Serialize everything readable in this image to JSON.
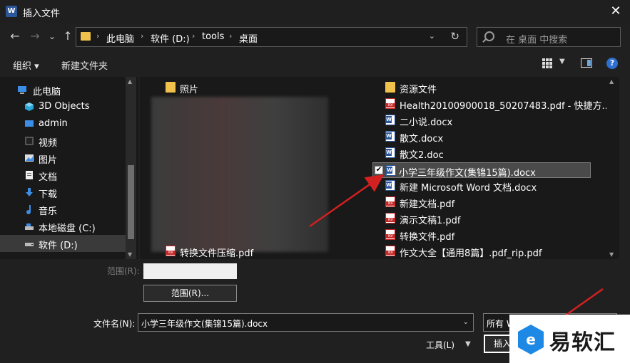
{
  "window": {
    "title": "插入文件",
    "app_icon_letter": "W",
    "close_glyph": "✕"
  },
  "nav": {
    "back_glyph": "←",
    "forward_glyph": "→",
    "recent_glyph": "⌄",
    "up_glyph": "↑",
    "breadcrumbs": [
      "此电脑",
      "软件 (D:)",
      "tools",
      "桌面"
    ],
    "separator": "›",
    "search_placeholder": "在 桌面 中搜索"
  },
  "toolbar": {
    "organize": "组织 ▾",
    "new_folder": "新建文件夹"
  },
  "sidebar": {
    "items": [
      {
        "label": "此电脑",
        "icon": "computer-icon"
      },
      {
        "label": "3D Objects",
        "icon": "cube-icon"
      },
      {
        "label": "admin",
        "icon": "desktop-icon"
      },
      {
        "label": "视频",
        "icon": "video-icon"
      },
      {
        "label": "图片",
        "icon": "picture-icon"
      },
      {
        "label": "文档",
        "icon": "document-icon"
      },
      {
        "label": "下载",
        "icon": "download-icon"
      },
      {
        "label": "音乐",
        "icon": "music-icon"
      },
      {
        "label": "本地磁盘 (C:)",
        "icon": "drive-icon"
      },
      {
        "label": "软件 (D:)",
        "icon": "drive-icon",
        "selected": true
      }
    ]
  },
  "files": {
    "left_column": [
      {
        "name": "照片",
        "type": "folder"
      },
      {
        "name": "转换文件压缩.pdf",
        "type": "pdf"
      }
    ],
    "right_column": [
      {
        "name": "资源文件",
        "type": "folder"
      },
      {
        "name": "Health20100900018_50207483.pdf - 快捷方...",
        "type": "pdf"
      },
      {
        "name": "二小说.docx",
        "type": "word"
      },
      {
        "name": "散文.docx",
        "type": "word"
      },
      {
        "name": "散文2.doc",
        "type": "word"
      },
      {
        "name": "小学三年级作文(集锦15篇).docx",
        "type": "word",
        "selected": true,
        "checked": true
      },
      {
        "name": "新建 Microsoft Word 文档.docx",
        "type": "word"
      },
      {
        "name": "新建文档.pdf",
        "type": "pdf"
      },
      {
        "name": "演示文稿1.pdf",
        "type": "pdf"
      },
      {
        "name": "转换文件.pdf",
        "type": "pdf"
      },
      {
        "name": "作文大全【通用8篇】.pdf_rip.pdf",
        "type": "pdf"
      }
    ]
  },
  "bottom": {
    "range_label": "范围(R):",
    "range_button": "范围(R)...",
    "filename_label": "文件名(N):",
    "filename_value": "小学三年级作文(集锦15篇).docx",
    "filetype_value": "所有 Word 文档 (*.doc...",
    "tools_label": "工具(L)",
    "insert_label": "插入"
  },
  "watermark": {
    "text": "易软汇"
  },
  "colors": {
    "accent": "#2b579a",
    "arrow": "#d32020",
    "folder": "#f0c24b"
  }
}
